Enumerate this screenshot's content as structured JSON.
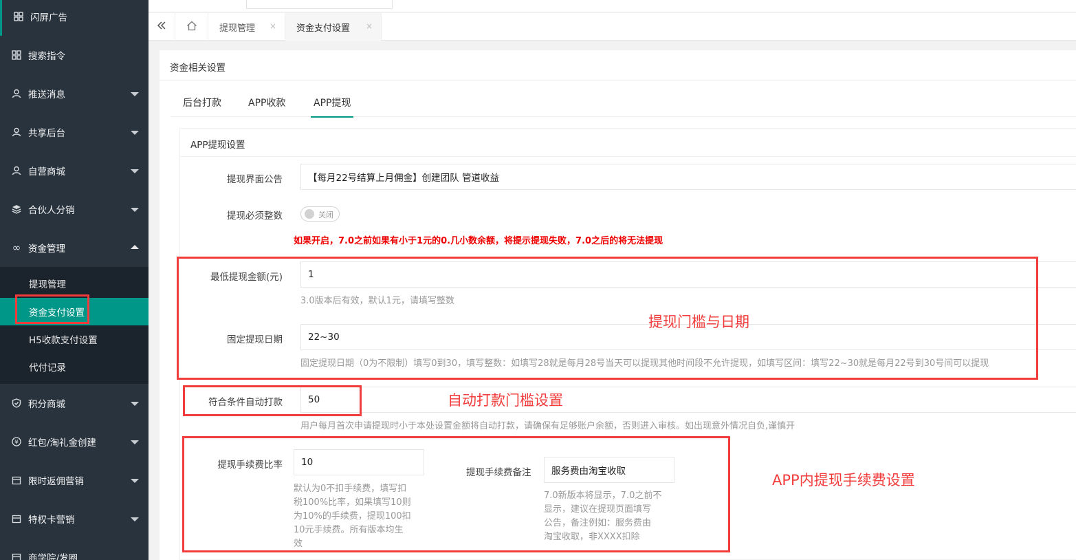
{
  "sidebar": {
    "items": [
      {
        "label": "闪屏广告",
        "icon": "grid-icon"
      },
      {
        "label": "搜索指令",
        "icon": "grid-icon"
      },
      {
        "label": "推送消息",
        "icon": "user-icon"
      },
      {
        "label": "共享后台",
        "icon": "user-icon"
      },
      {
        "label": "自营商城",
        "icon": "user-icon"
      },
      {
        "label": "合伙人分销",
        "icon": "layers-icon"
      },
      {
        "label": "资金管理",
        "icon": "infinity-icon"
      },
      {
        "label": "积分商城",
        "icon": "shield-icon"
      },
      {
        "label": "红包/淘礼金创建",
        "icon": "yen-icon"
      },
      {
        "label": "限时返佣营销",
        "icon": "calendar-icon"
      },
      {
        "label": "特权卡营销",
        "icon": "calendar-icon"
      },
      {
        "label": "商学院/发圈",
        "icon": "calendar-icon"
      }
    ],
    "sub_items": [
      "提现管理",
      "资金支付设置",
      "H5收款支付设置",
      "代付记录"
    ]
  },
  "tabs": {
    "items": [
      {
        "label": "提现管理",
        "close": "×"
      },
      {
        "label": "资金支付设置",
        "close": "×"
      }
    ]
  },
  "panel": {
    "title": "资金相关设置",
    "subtabs": [
      "后台打款",
      "APP收款",
      "APP提现"
    ]
  },
  "form": {
    "section_title": "APP提现设置",
    "notice_label": "提现界面公告",
    "notice_value": "【每月22号结算上月佣金】创建团队  管道收益",
    "integer_label": "提现必须整数",
    "integer_switch_text": "关闭",
    "warning": "如果开启，7.0之前如果有小于1元的0.几小数余额，将提示提现失败，7.0之后的将无法提现",
    "min_amount_label": "最低提现金额(元)",
    "min_amount_value": "1",
    "min_amount_hint": "3.0版本后有效，默认1元，请填写整数",
    "fixed_date_label": "固定提现日期",
    "fixed_date_value": "22~30",
    "fixed_date_hint": "固定提现日期（0为不限制）填写0到30，填写整数：如填写28就是每月28号当天可以提现其他时间段不允许提现，如填写区间：填写22~30就是每月22号到30号间可以提现",
    "auto_pay_label": "符合条件自动打款",
    "auto_pay_value": "50",
    "auto_pay_hint": "用户每月首次申请提现时小于本处设置金额将自动打款，请确保有足够账户余额，否则进入审核。如出现意外情况自负,谨慎开",
    "fee_rate_label": "提现手续费比率",
    "fee_rate_value": "10",
    "fee_rate_hint_lines": [
      "默认为0不扣手续费，填写扣",
      "税100%比率，如果填写10则",
      "为10%的手续费，提现100扣",
      "10元手续费。所有版本均生",
      "效"
    ],
    "fee_note_label": "提现手续费备注",
    "fee_note_value": "服务费由淘宝收取",
    "fee_note_hint_lines": [
      "7.0新版本将显示，7.0之前不",
      "显示，建议在提现页面填写",
      "公告，备注例如：服务费由",
      "淘宝收取，非XXXX扣除"
    ]
  },
  "annotations": {
    "threshold_date": "提现门槛与日期",
    "auto_pay": "自动打款门槛设置",
    "fee": "APP内提现手续费设置"
  },
  "colors": {
    "accent": "#009688",
    "annotation": "#f03c3c",
    "sidebar": "#28333e"
  }
}
